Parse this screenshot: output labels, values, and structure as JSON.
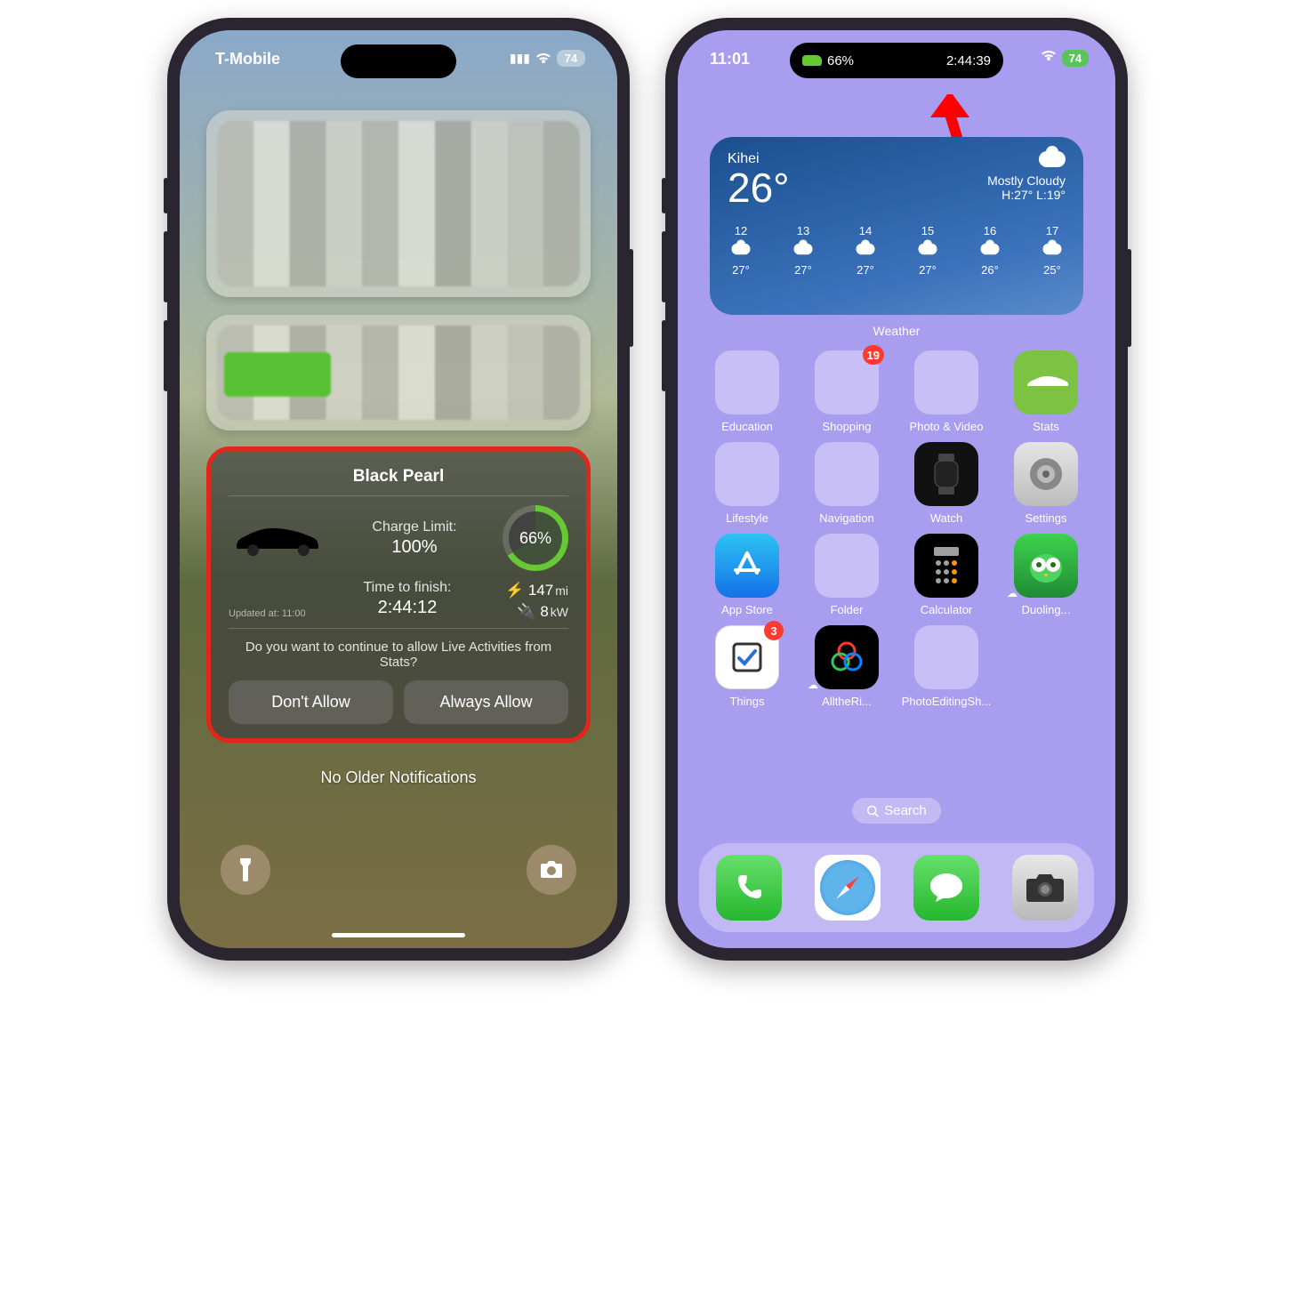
{
  "left": {
    "carrier": "T-Mobile",
    "battery": "74",
    "live": {
      "title": "Black Pearl",
      "charge_label": "Charge Limit:",
      "charge_value": "100%",
      "ring": "66%",
      "time_label": "Time to finish:",
      "time_value": "2:44:12",
      "updated": "Updated at: 11:00",
      "range": "147",
      "range_unit": "mi",
      "power": "8",
      "power_unit": "kW",
      "question": "Do you want to continue to allow Live Activities from Stats?",
      "dont": "Don't Allow",
      "always": "Always Allow"
    },
    "no_older": "No Older Notifications"
  },
  "right": {
    "time": "11:01",
    "island_pct": "66%",
    "island_timer": "2:44:39",
    "battery": "74",
    "weather": {
      "location": "Kihei",
      "temp": "26°",
      "cond": "Mostly Cloudy",
      "hilo": "H:27° L:19°",
      "hours": [
        {
          "h": "12",
          "t": "27°"
        },
        {
          "h": "13",
          "t": "27°"
        },
        {
          "h": "14",
          "t": "27°"
        },
        {
          "h": "15",
          "t": "27°"
        },
        {
          "h": "16",
          "t": "26°"
        },
        {
          "h": "17",
          "t": "25°"
        }
      ],
      "label": "Weather"
    },
    "apps": {
      "education": "Education",
      "shopping": "Shopping",
      "photovideo": "Photo & Video",
      "stats": "Stats",
      "lifestyle": "Lifestyle",
      "navigation": "Navigation",
      "watch": "Watch",
      "settings": "Settings",
      "appstore": "App Store",
      "folder": "Folder",
      "calculator": "Calculator",
      "duolingo": "Duoling...",
      "things": "Things",
      "allthe": "AlltheRi...",
      "photoedit": "PhotoEditingSh..."
    },
    "badges": {
      "shopping": "19",
      "things": "3"
    },
    "search": "Search"
  }
}
